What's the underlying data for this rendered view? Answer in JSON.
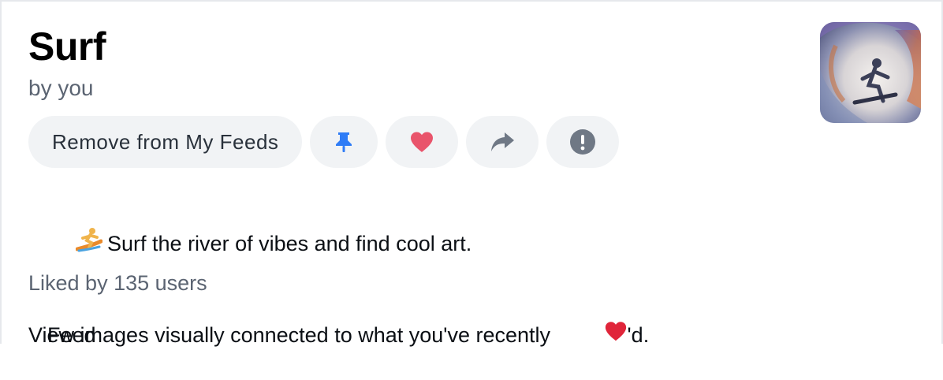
{
  "feed": {
    "title": "Surf",
    "byline": "by you",
    "avatar_icon": "surfer-art-avatar"
  },
  "actions": {
    "remove_label": "Remove from My Feeds",
    "pin_icon": "pin-icon",
    "like_icon": "heart-icon",
    "share_icon": "share-arrow-icon",
    "report_icon": "exclamation-circle-icon"
  },
  "description": {
    "line1_emoji": "surfer-emoji",
    "line1": "Surf the river of vibes and find cool art.",
    "line2_pre": "View images visually connected to what you've recently ",
    "line2_emoji": "red-heart-emoji",
    "line2_post": "'d."
  },
  "likes": {
    "text": "Liked by 135 users"
  },
  "tabs": {
    "feed_label": "Feed"
  },
  "colors": {
    "pin": "#2f7cf6",
    "heart": "#e9546b",
    "muted_icon": "#6f7885",
    "button_bg": "#f1f3f5"
  }
}
